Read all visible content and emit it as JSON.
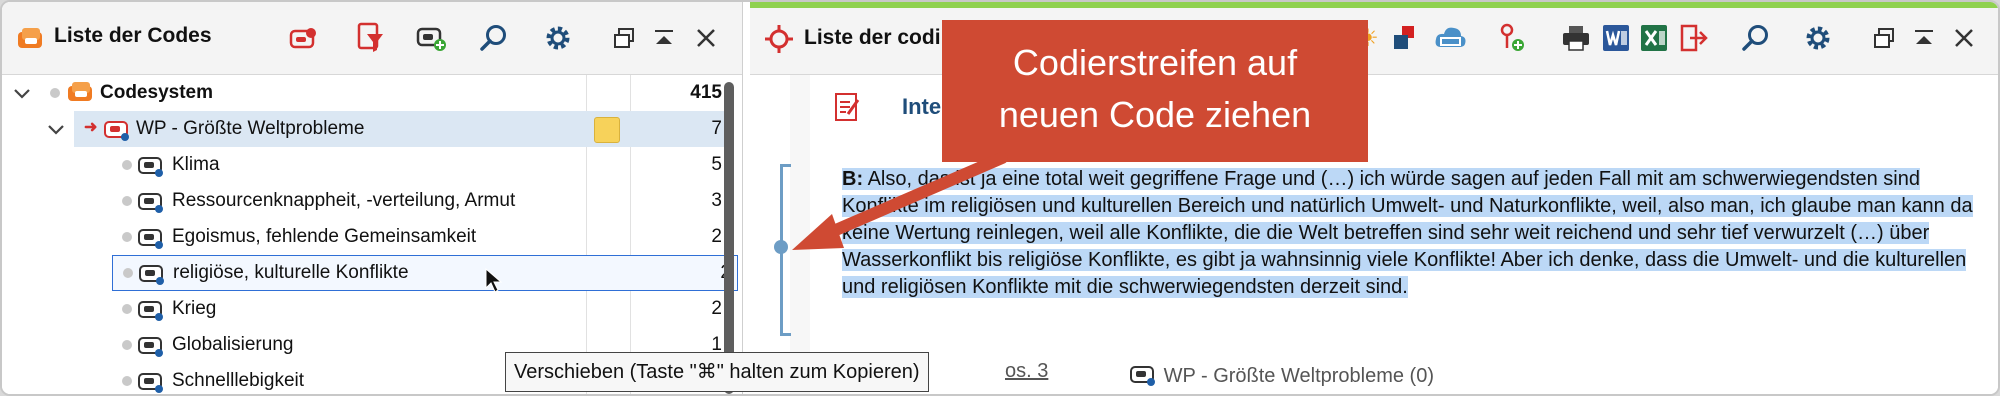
{
  "left_panel": {
    "title": "Liste der Codes",
    "toolbar_icons": [
      "activate-codes-icon",
      "filter-codes-icon",
      "new-code-icon",
      "search-icon",
      "gear-icon",
      "undock-icon",
      "collapse-icon",
      "close-icon"
    ],
    "tree": {
      "root": {
        "label": "Codesystem",
        "count": "415"
      },
      "parent": {
        "label": "WP - Größte Weltprobleme",
        "count": "7",
        "has_memo": true
      },
      "children": [
        {
          "label": "Klima",
          "count": "5"
        },
        {
          "label": "Ressourcenknappheit, -verteilung, Armut",
          "count": "3"
        },
        {
          "label": "Egoismus, fehlende Gemeinsamkeit",
          "count": "2"
        },
        {
          "label": "religiöse, kulturelle Konflikte",
          "count": "2",
          "selected": true
        },
        {
          "label": "Krieg",
          "count": "2"
        },
        {
          "label": "Globalisierung",
          "count": "1"
        },
        {
          "label": "Schnelllebigkeit",
          "count": ""
        }
      ]
    }
  },
  "right_panel": {
    "title": "Liste der codi",
    "toolbar_icons": [
      "highlight-icon",
      "color-code-icon",
      "abc-cloud-icon",
      "new-code-icon",
      "print-icon",
      "word-export-icon",
      "excel-export-icon",
      "export-icon",
      "search-icon",
      "gear-icon",
      "undock-icon",
      "collapse-icon",
      "close-icon"
    ],
    "doc_title": "Inte",
    "segment": {
      "speaker": "B:",
      "text": " Also, das ist ja eine total weit gegriffene Frage und (…) ich würde sagen auf jeden Fall mit am schwerwiegendsten sind Konflikte im religiösen und kulturellen Bereich und natürlich Umwelt- und Naturkonflikte, weil, also man, ich glaube man kann da keine Wertung reinlegen, weil alle Konflikte, die die Welt betreffen sind sehr weit reichend und sehr tief verwurzelt (…) über Wasserkonflikt bis religiöse Konflikte, es gibt ja wahnsinnig viele Konflikte! Aber ich denke, dass die Umwelt- und die kulturellen und religiösen Konflikte mit die schwerwiegendsten derzeit sind."
    },
    "position_link": "os. 3",
    "segment_code": "WP - Größte Weltprobleme (0)"
  },
  "callout": {
    "line1": "Codierstreifen auf",
    "line2": "neuen Code ziehen",
    "color": "#cf4a33"
  },
  "tooltip": "Verschieben (Taste \"⌘\" halten zum Kopieren)",
  "colors": {
    "accent_green": "#8fd14f",
    "selection": "#bcd8f6",
    "code_blue": "#1f4d7a"
  }
}
